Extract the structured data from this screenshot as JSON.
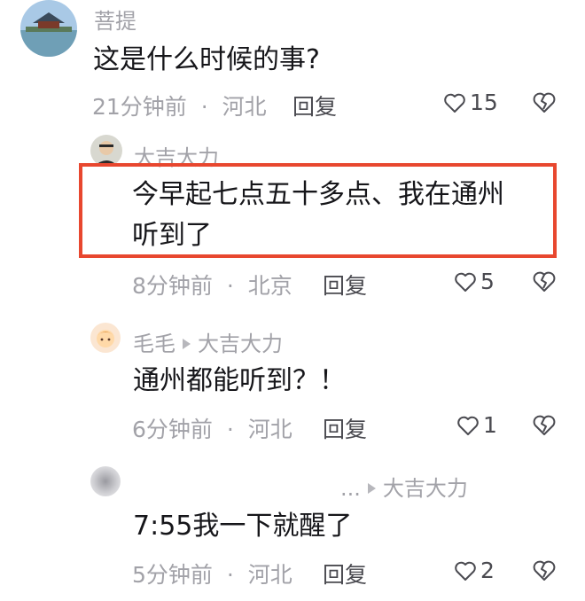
{
  "comments": [
    {
      "author": "菩提",
      "text": "这是什么时候的事?",
      "time": "21分钟前",
      "location": "河北",
      "reply_label": "回复",
      "likes": "15"
    },
    {
      "author": "大吉大力",
      "text_line1": "今早起七点五十多点、我在通州",
      "text_line2": "听到了",
      "time": "8分钟前",
      "location": "北京",
      "reply_label": "回复",
      "likes": "5"
    },
    {
      "author": "毛毛",
      "reply_to": "大吉大力",
      "text": "通州都能听到？！",
      "time": "6分钟前",
      "location": "河北",
      "reply_label": "回复",
      "likes": "1"
    },
    {
      "author": "...",
      "reply_to": "大吉大力",
      "text": "7:55我一下就醒了",
      "time": "5分钟前",
      "location": "河北",
      "reply_label": "回复",
      "likes": "2"
    }
  ],
  "separator": "·",
  "colors": {
    "highlight_border": "#e8472f",
    "meta_text": "#a2a2a8",
    "body_text": "#16161a"
  },
  "icons": [
    "heart-outline-icon",
    "broken-heart-icon",
    "reply-arrow-icon"
  ]
}
